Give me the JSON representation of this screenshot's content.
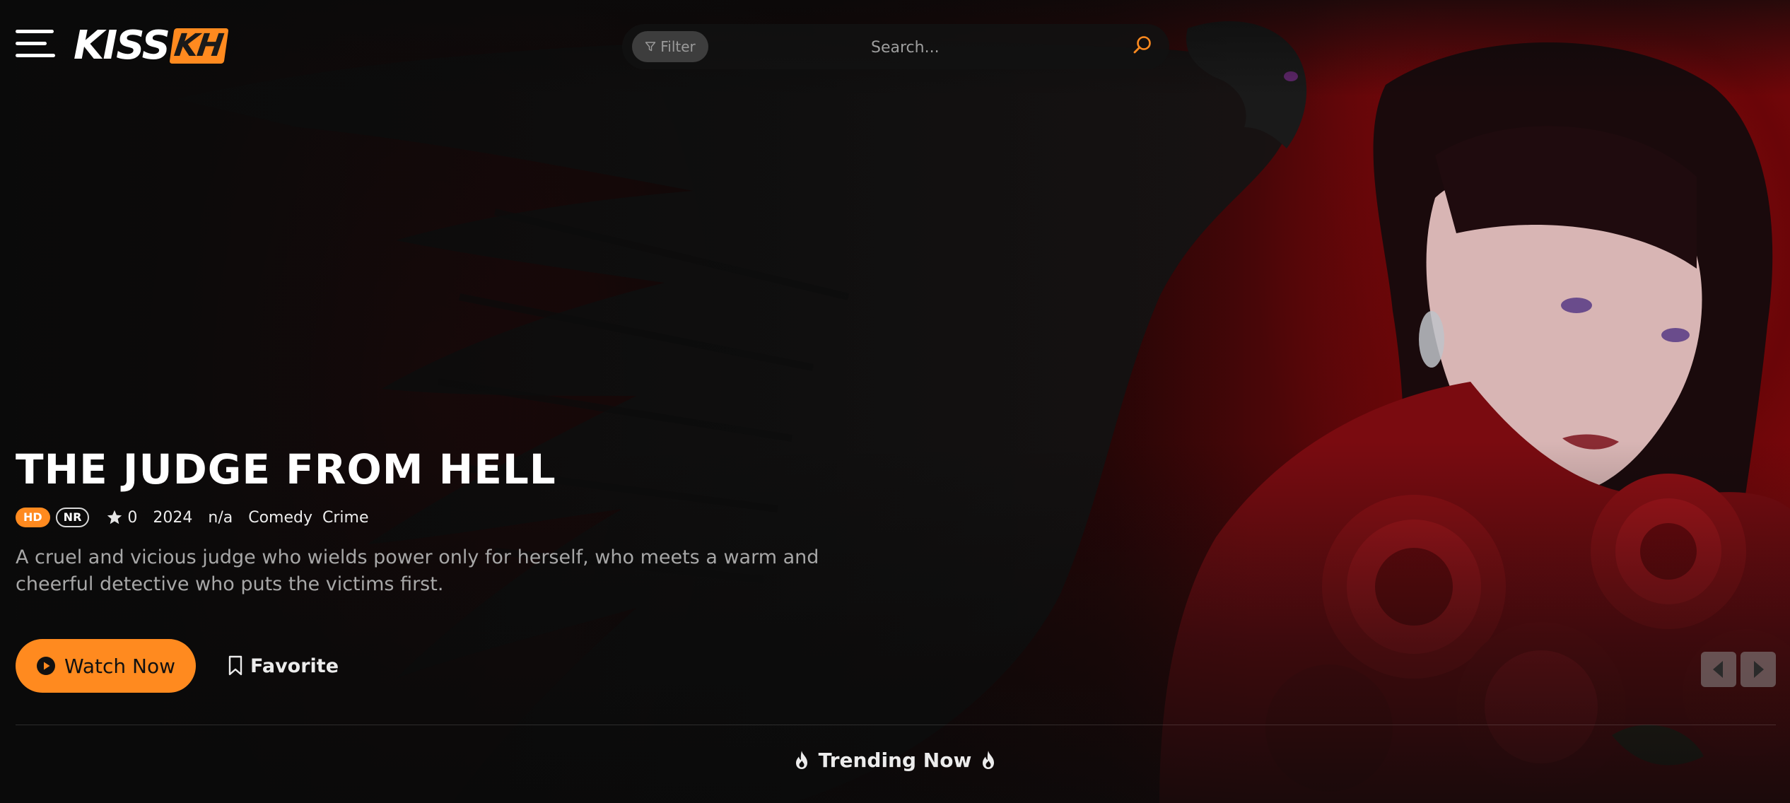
{
  "brand": {
    "logo_part1": "KISS",
    "logo_part2": "KH",
    "accent_color": "#ff8a1f"
  },
  "header": {
    "menu_icon": "hamburger-menu-icon",
    "filter_label": "Filter",
    "filter_icon": "funnel-icon",
    "search_placeholder": "Search...",
    "search_icon": "search-icon"
  },
  "hero": {
    "title": "THE JUDGE FROM HELL",
    "badges": [
      "HD",
      "NR"
    ],
    "rating": "0",
    "rating_icon": "star-icon",
    "year": "2024",
    "duration": "n/a",
    "genres": [
      "Comedy",
      "Crime"
    ],
    "description": "A cruel and vicious judge who wields power only for herself, who meets a warm and cheerful detective who puts the victims first.",
    "watch_label": "Watch Now",
    "watch_icon": "play-circle-icon",
    "favorite_label": "Favorite",
    "favorite_icon": "bookmark-icon",
    "slider_prev_icon": "caret-left-icon",
    "slider_next_icon": "caret-right-icon"
  },
  "trending": {
    "label": "Trending Now",
    "icon": "flame-icon"
  }
}
